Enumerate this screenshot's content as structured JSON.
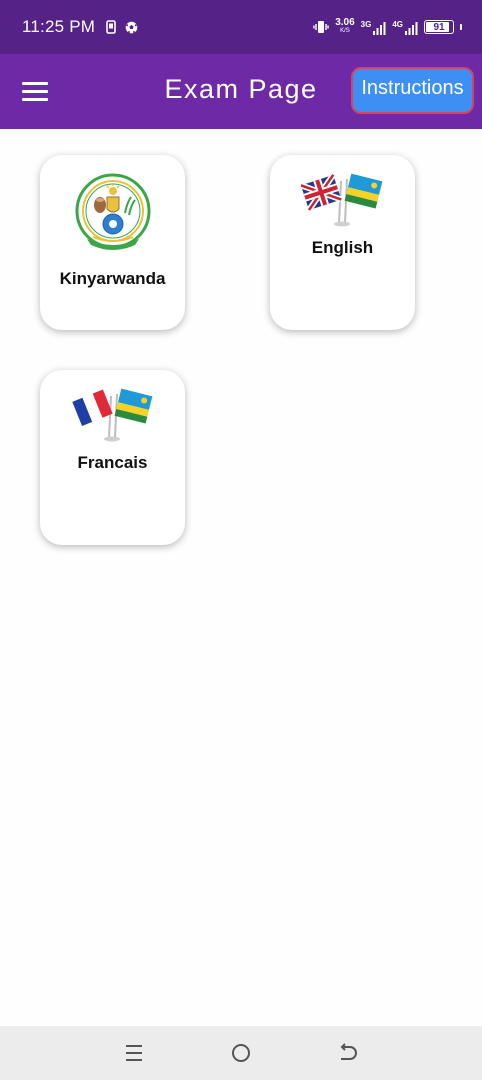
{
  "status_bar": {
    "time": "11:25 PM",
    "speed_value": "3.06",
    "speed_unit": "K/S",
    "network_1": "3G",
    "network_2": "4G",
    "battery": "91",
    "battery_level": 0.91
  },
  "app_bar": {
    "title": "Exam Page",
    "instructions_label": "Instructions",
    "colors": {
      "app_bar": "#6e2aa6",
      "status_bar": "#552388",
      "button": "#3d8ff4",
      "button_border": "#d6455e"
    }
  },
  "languages": [
    {
      "label": "Kinyarwanda",
      "icon": "rwanda-coat-of-arms-icon"
    },
    {
      "label": "English",
      "icon": "uk-rwanda-flags-icon"
    },
    {
      "label": "Francais",
      "icon": "france-rwanda-flags-icon"
    }
  ],
  "nav_bar": {
    "icons": [
      "recent-apps-icon",
      "home-icon",
      "back-icon"
    ]
  }
}
